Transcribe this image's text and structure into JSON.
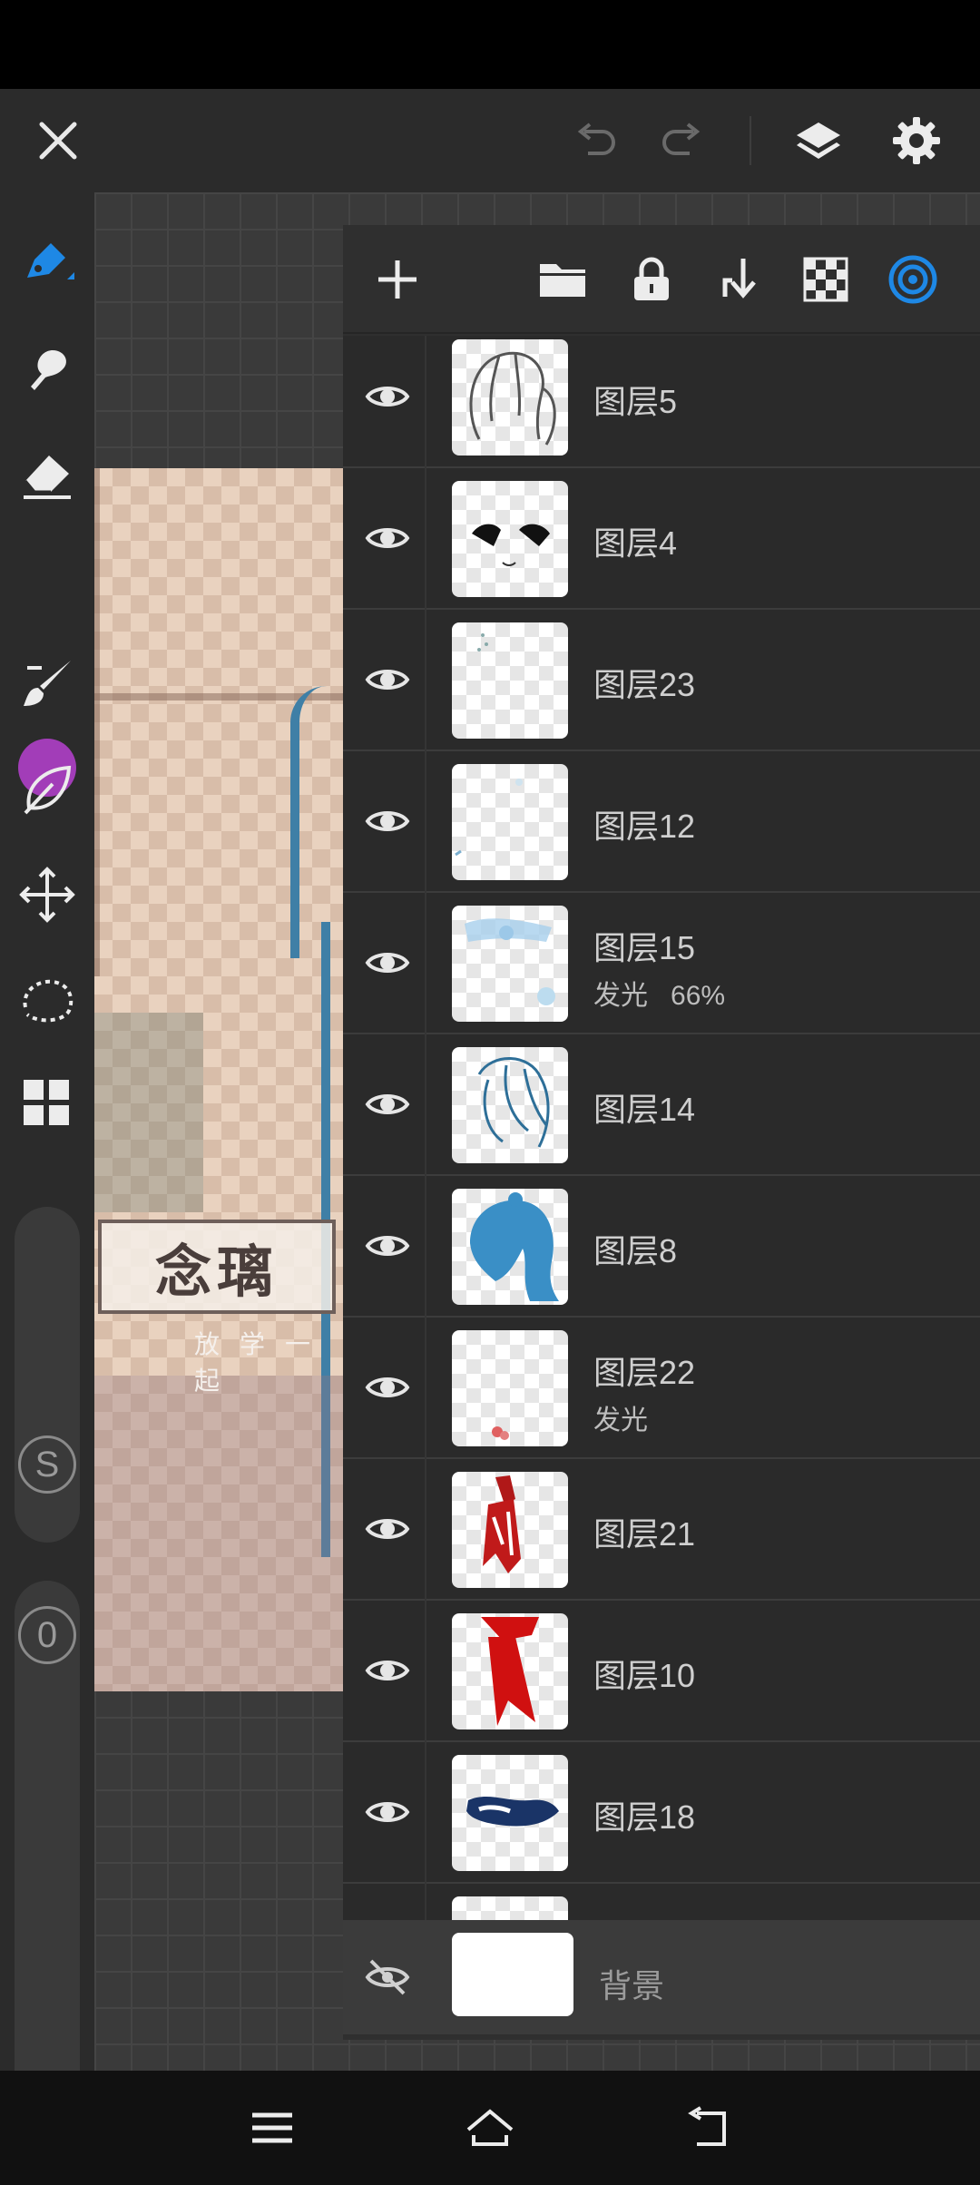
{
  "app": {
    "accent_color": "#1e88e5",
    "current_color": "#a23db8"
  },
  "top_bar": {
    "icons": [
      "close-icon",
      "undo-icon",
      "redo-icon",
      "layers-icon",
      "gear-icon"
    ]
  },
  "left_toolbar": {
    "tools": [
      "pen-tool-icon",
      "smudge-tool-icon",
      "eraser-icon",
      "color-swatch",
      "brush-icon",
      "leaf-icon",
      "move-icon",
      "lasso-select-icon",
      "grid-icon"
    ],
    "slider_size_label": "S",
    "slider_opacity_label": "0"
  },
  "canvas": {
    "sign_text": "念璃",
    "sign_subtext": "放学一起"
  },
  "layers_panel": {
    "toolbar_icons": [
      "add-icon",
      "folder-icon",
      "lock-icon",
      "merge-down-icon",
      "checkerboard-icon",
      "target-icon"
    ],
    "layers": [
      {
        "name": "图层5",
        "sub": "",
        "visible": true,
        "thumb": "hair-sketch"
      },
      {
        "name": "图层4",
        "sub": "",
        "visible": true,
        "thumb": "eyes"
      },
      {
        "name": "图层23",
        "sub": "",
        "visible": true,
        "thumb": "dots"
      },
      {
        "name": "图层12",
        "sub": "",
        "visible": true,
        "thumb": "faint"
      },
      {
        "name": "图层15",
        "sub": "发光   66%",
        "visible": true,
        "thumb": "glow-blue"
      },
      {
        "name": "图层14",
        "sub": "",
        "visible": true,
        "thumb": "hair-lines-blue"
      },
      {
        "name": "图层8",
        "sub": "",
        "visible": true,
        "thumb": "hair-fill-blue"
      },
      {
        "name": "图层22",
        "sub": "发光",
        "visible": true,
        "thumb": "small-red"
      },
      {
        "name": "图层21",
        "sub": "",
        "visible": true,
        "thumb": "red-ribbon-dark"
      },
      {
        "name": "图层10",
        "sub": "",
        "visible": true,
        "thumb": "red-ribbon"
      },
      {
        "name": "图层18",
        "sub": "",
        "visible": true,
        "thumb": "navy-shape"
      }
    ],
    "background_layer": {
      "name": "背景",
      "visible": false
    }
  },
  "nav_bar": {
    "icons": [
      "menu-icon",
      "home-icon",
      "back-icon"
    ]
  }
}
